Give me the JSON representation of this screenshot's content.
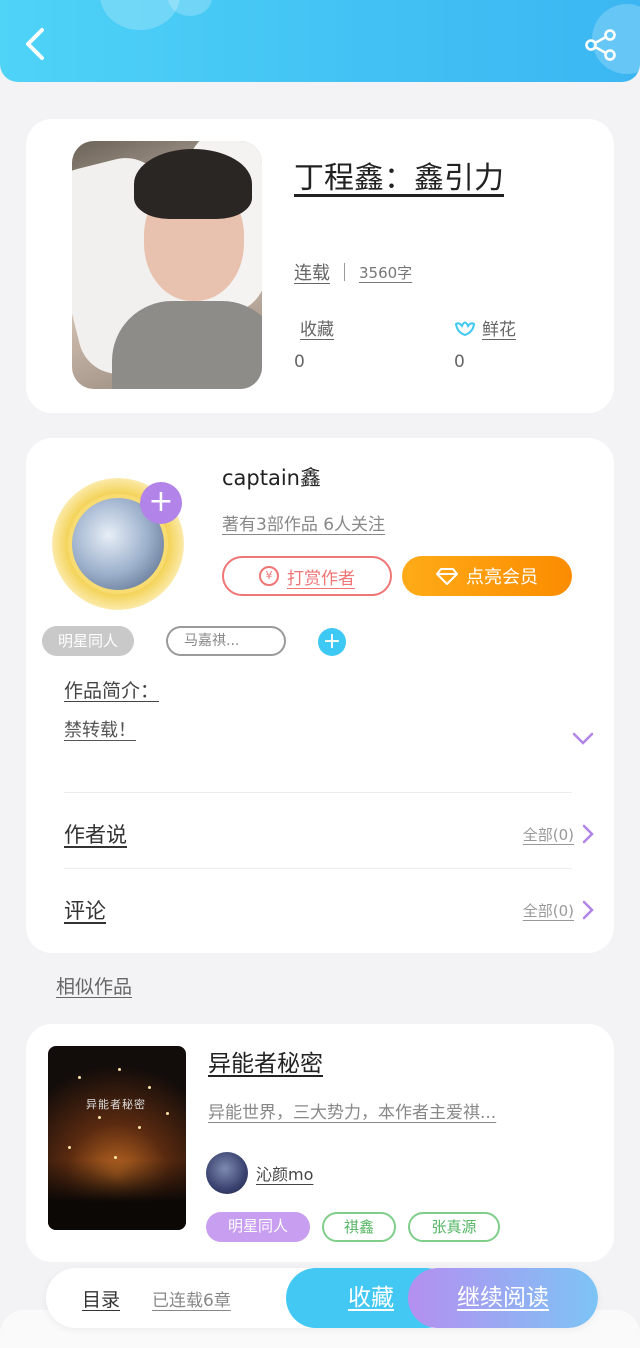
{
  "header": {
    "back_icon": "back-arrow-icon",
    "share_icon": "share-icon",
    "color": "#43c4f4"
  },
  "book": {
    "title": "丁程鑫：鑫引力",
    "status": "连载",
    "word_count": "3560字",
    "favorites_label": "收藏",
    "favorites_value": "0",
    "flowers_label": "鲜花",
    "flowers_value": "0"
  },
  "author": {
    "name": "captain鑫",
    "summary": "著有3部作品 6人关注",
    "tip_button": "打赏作者",
    "vip_button": "点亮会员",
    "tags": [
      "明星同人",
      "马嘉祺..."
    ],
    "intro_title": "作品简介：",
    "intro_text": "禁转载！",
    "rows": [
      {
        "label": "作者说",
        "meta": "全部(0)"
      },
      {
        "label": "评论",
        "meta": "全部(0)"
      }
    ]
  },
  "similar": {
    "section_title": "相似作品",
    "cover_text": "异能者秘密",
    "title": "异能者秘密",
    "description": "异能世界，三大势力，本作者主爱祺...",
    "author_name": "沁颜mo",
    "tags": [
      "明星同人",
      "祺鑫",
      "张真源"
    ]
  },
  "bottom_bar": {
    "toc": "目录",
    "status": "已连载6章",
    "favorite": "收藏",
    "continue": "继续阅读"
  },
  "colors": {
    "accent_blue": "#43c8f4",
    "tip_red": "#f07575",
    "vip_orange": "#fb8c00",
    "purple": "#b283e8",
    "green": "#7fce8a"
  }
}
